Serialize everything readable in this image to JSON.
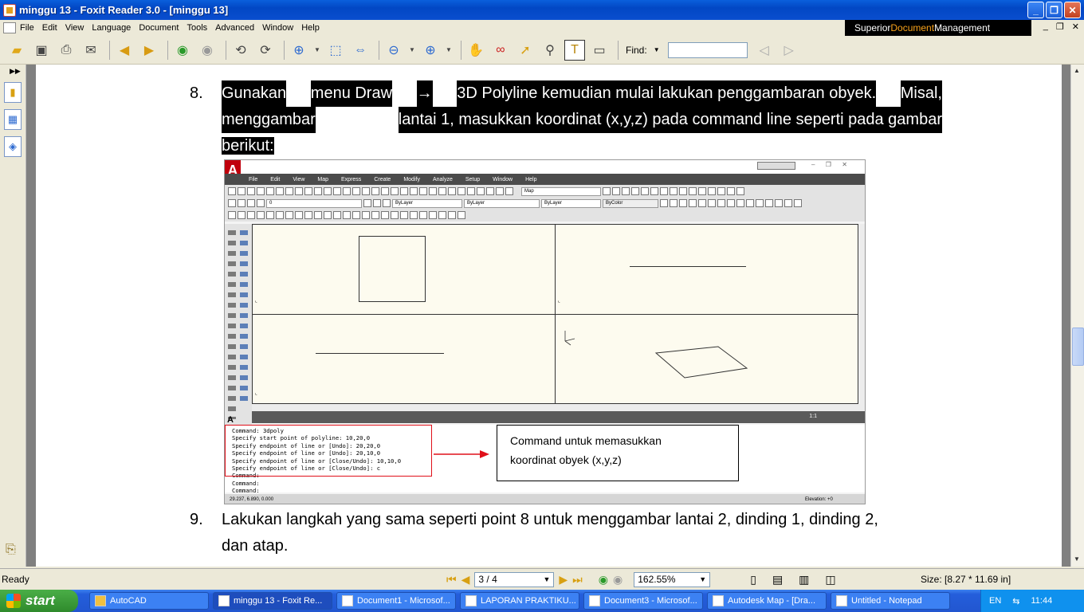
{
  "window": {
    "title": "minggu 13 - Foxit Reader 3.0 - [minggu 13]"
  },
  "menu": [
    "File",
    "Edit",
    "View",
    "Language",
    "Document",
    "Tools",
    "Advanced",
    "Window",
    "Help"
  ],
  "banner": {
    "prefix": "Superior ",
    "highlight": "Document",
    "suffix": " Management"
  },
  "toolbar": {
    "find_label": "Find:",
    "find_value": ""
  },
  "document": {
    "item8_number": "8.",
    "item8_line1": [
      "Gunakan",
      "menu Draw",
      "→",
      "3D Polyline kemudian mulai lakukan penggambaran obyek.",
      "Misal,"
    ],
    "item8_line2": [
      "menggambar",
      "lantai 1, masukkan koordinat (x,y,z) pada command line seperti pada gambar"
    ],
    "item8_line3": "berikut:",
    "item9_number": "9.",
    "item9_line1": "Lakukan langkah yang sama seperti point 8 untuk menggambar lantai 2, dinding 1, dinding 2,",
    "item9_line2": "dan atap.",
    "callout_line1": "Command untuk memasukkan",
    "callout_line2": "koordinat obyek (x,y,z)"
  },
  "autocad": {
    "menu": [
      "File",
      "Edit",
      "View",
      "Map",
      "Express",
      "Create",
      "Modify",
      "Analyze",
      "Setup",
      "Window",
      "Help"
    ],
    "workspace": "Map",
    "layer": "0",
    "bylayer1": "ByLayer",
    "bylayer2": "ByLayer",
    "bylayer3": "ByLayer",
    "bycolor": "ByColor",
    "scale": "1:1",
    "command_lines": [
      "Command: 3dpoly",
      "Specify start point of polyline: 10,20,0",
      "Specify endpoint of line or [Undo]: 20,20,0",
      "Specify endpoint of line or [Undo]: 20,10,0",
      "Specify endpoint of line or [Close/Undo]: 10,10,0",
      "Specify endpoint of line or [Close/Undo]: c",
      "Command:",
      "Command:",
      "Command:"
    ],
    "coords": "29.237, 6.890, 0.000",
    "elevation": "Elevation: +0"
  },
  "status": {
    "ready": "Ready",
    "page": "3 / 4",
    "zoom": "162.55%",
    "size": "Size: [8.27 * 11.69 in]"
  },
  "taskbar": {
    "start": "start",
    "tasks": [
      "AutoCAD",
      "minggu 13 - Foxit Re...",
      "Document1 - Microsof...",
      "LAPORAN PRAKTIKU...",
      "Document3 - Microsof...",
      "Autodesk Map - [Dra...",
      "Untitled - Notepad"
    ],
    "lang": "EN",
    "clock": "11:44"
  }
}
